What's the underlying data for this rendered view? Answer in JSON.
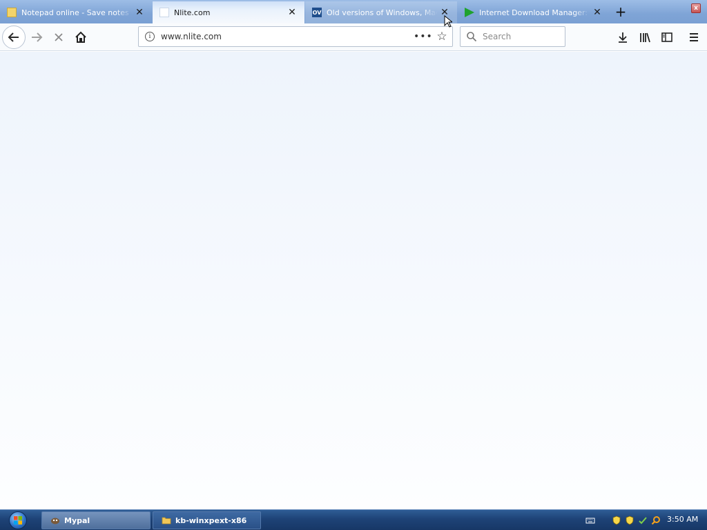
{
  "browser": {
    "tabs": [
      {
        "title": "Notepad online - Save notes o",
        "favicon": "notepad-icon",
        "state": "inactive"
      },
      {
        "title": "Nlite.com",
        "favicon": "blank-page-icon",
        "state": "active"
      },
      {
        "title": "Old versions of Windows, Mac",
        "favicon": "ov-icon",
        "favicon_text": "OV",
        "state": "hover"
      },
      {
        "title": "Internet Download Manager: \\",
        "favicon": "idm-arrow-icon",
        "state": "inactive"
      }
    ],
    "new_tab_label": "+",
    "close_window_label": "x",
    "url": "www.nlite.com",
    "search_placeholder": "Search",
    "accent_color": "#7fa4d6"
  },
  "taskbar": {
    "items": [
      {
        "label": "Mypal",
        "icon": "mypal-icon"
      },
      {
        "label": "kb-winxpext-x86",
        "icon": "folder-icon"
      }
    ],
    "tray_icons": [
      "keyboard-icon",
      "shield-icon",
      "shield-icon",
      "network-icon",
      "search-icon"
    ],
    "clock": "3:50 AM"
  }
}
